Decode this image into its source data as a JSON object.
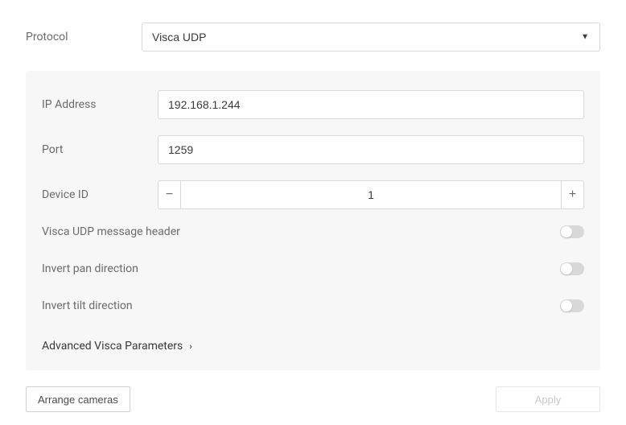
{
  "protocol": {
    "label": "Protocol",
    "value": "Visca UDP"
  },
  "panel": {
    "ip_address": {
      "label": "IP Address",
      "value": "192.168.1.244"
    },
    "port": {
      "label": "Port",
      "value": "1259"
    },
    "device_id": {
      "label": "Device ID",
      "value": "1"
    },
    "toggles": {
      "visca_header": {
        "label": "Visca UDP message header",
        "on": false
      },
      "invert_pan": {
        "label": "Invert pan direction",
        "on": false
      },
      "invert_tilt": {
        "label": "Invert tilt direction",
        "on": false
      }
    },
    "advanced_link": "Advanced Visca Parameters"
  },
  "footer": {
    "arrange_label": "Arrange cameras",
    "apply_label": "Apply"
  }
}
